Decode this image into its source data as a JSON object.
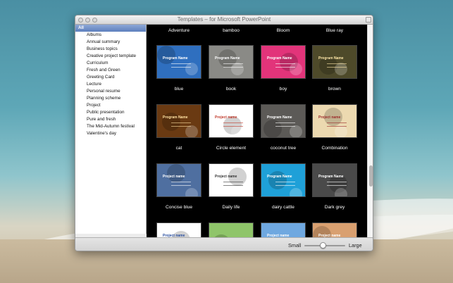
{
  "window": {
    "title": "Templates – for Microsoft PowerPoint"
  },
  "sidebar": {
    "items": [
      {
        "label": "All",
        "selected": true
      },
      {
        "label": "Albums"
      },
      {
        "label": "Annual summary"
      },
      {
        "label": "Business topics"
      },
      {
        "label": "Creative project template"
      },
      {
        "label": "Curriculum"
      },
      {
        "label": "Fresh and Green"
      },
      {
        "label": "Greeting Card"
      },
      {
        "label": "Lecture"
      },
      {
        "label": "Personal resume"
      },
      {
        "label": "Planning scheme"
      },
      {
        "label": "Project"
      },
      {
        "label": "Public presentation"
      },
      {
        "label": "Pure and fresh"
      },
      {
        "label": "The Mid-Autumn festival"
      },
      {
        "label": "Valentine's day"
      }
    ]
  },
  "grid": {
    "top_labels": [
      "Adventure",
      "bamboo",
      "Bloom",
      "Blue ray"
    ],
    "rows": [
      [
        {
          "name": "blue",
          "thumb_text": "Program Name",
          "bg": "#2f6fbf",
          "fg": "#ffffff"
        },
        {
          "name": "book",
          "thumb_text": "Program Name",
          "bg": "#8a8a86",
          "fg": "#ffffff"
        },
        {
          "name": "boy",
          "thumb_text": "Program Name",
          "bg": "#e2347a",
          "fg": "#ffffff"
        },
        {
          "name": "brown",
          "thumb_text": "Program Name",
          "bg": "#4e4a2a",
          "fg": "#ffe8a8"
        }
      ],
      [
        {
          "name": "cat",
          "thumb_text": "Program Name",
          "bg": "#6a3a12",
          "fg": "#ffe0a0"
        },
        {
          "name": "Circle element",
          "thumb_text": "Project name",
          "bg": "#ffffff",
          "fg": "#c0392b"
        },
        {
          "name": "coconut tree",
          "thumb_text": "Program Name",
          "bg": "#5c5a57",
          "fg": "#ffffff"
        },
        {
          "name": "Combination",
          "thumb_text": "Project name",
          "bg": "#ecd9b0",
          "fg": "#9b2a2a"
        }
      ],
      [
        {
          "name": "Concise blue",
          "thumb_text": "Project name",
          "bg": "#4f6fa0",
          "fg": "#ffffff"
        },
        {
          "name": "Daily life",
          "thumb_text": "Project name",
          "bg": "#ffffff",
          "fg": "#333333"
        },
        {
          "name": "dairy cattle",
          "thumb_text": "Program Name",
          "bg": "#1fa0d8",
          "fg": "#ffffff"
        },
        {
          "name": "Dark grey",
          "thumb_text": "Program Name",
          "bg": "#4a4a4a",
          "fg": "#ffffff"
        }
      ],
      [
        {
          "name": "",
          "thumb_text": "Project name",
          "bg": "#ffffff",
          "fg": "#2a4fa0"
        },
        {
          "name": "",
          "thumb_text": "",
          "bg": "#8fc56a",
          "fg": "#ffffff"
        },
        {
          "name": "",
          "thumb_text": "Project name",
          "bg": "#6fa8e0",
          "fg": "#ffffff"
        },
        {
          "name": "",
          "thumb_text": "Project name",
          "bg": "#d9a070",
          "fg": "#ffffff"
        }
      ]
    ]
  },
  "bottombar": {
    "small_label": "Small",
    "large_label": "Large",
    "size_slider_fraction": 0.45
  },
  "colors": {
    "selection": "#5d7fbd",
    "content_bg": "#000000"
  }
}
